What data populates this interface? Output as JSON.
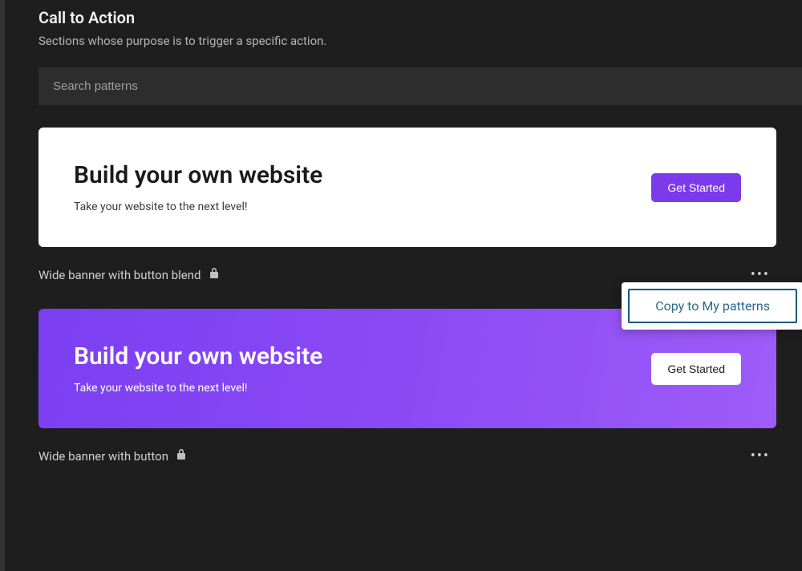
{
  "header": {
    "title": "Call to Action",
    "subtitle": "Sections whose purpose is to trigger a specific action."
  },
  "search": {
    "placeholder": "Search patterns"
  },
  "patterns": [
    {
      "card_title": "Build your own website",
      "card_subtitle": "Take your website to the next level!",
      "button_label": "Get Started",
      "label": "Wide banner with button blend"
    },
    {
      "card_title": "Build your own website",
      "card_subtitle": "Take your website to the next level!",
      "button_label": "Get Started",
      "label": "Wide banner with button"
    }
  ],
  "context_menu": {
    "copy_label": "Copy to My patterns"
  }
}
